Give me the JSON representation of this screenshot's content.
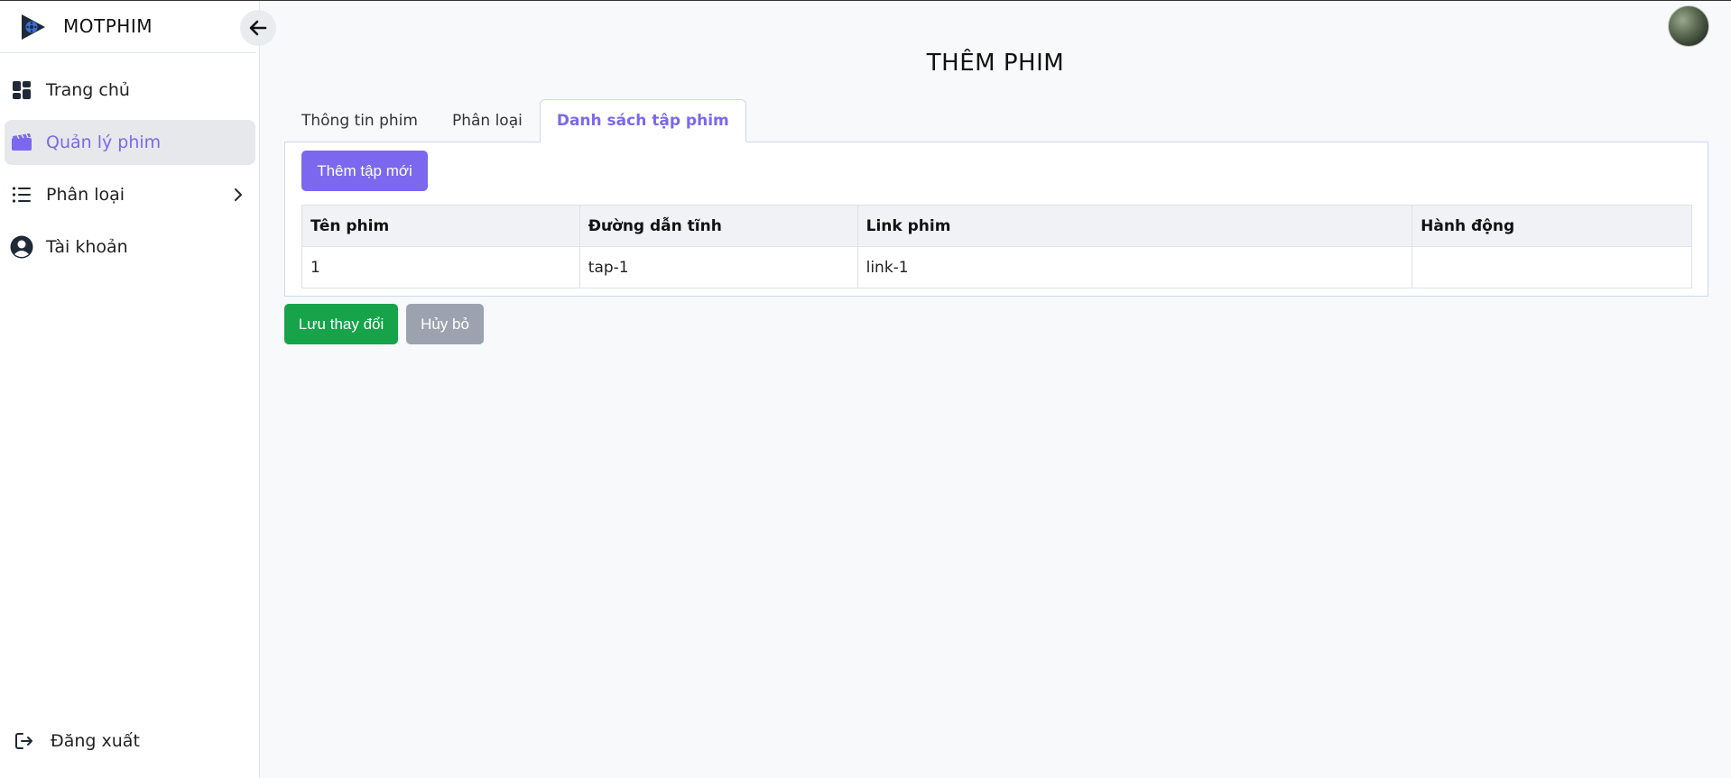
{
  "app": {
    "name": "MOTPHIM"
  },
  "sidebar": {
    "items": [
      {
        "label": "Trang chủ",
        "icon": "dashboard-icon"
      },
      {
        "label": "Quản lý phim",
        "icon": "film-icon",
        "active": true
      },
      {
        "label": "Phân loại",
        "icon": "list-icon"
      },
      {
        "label": "Tài khoản",
        "icon": "user-circle-icon"
      }
    ],
    "logout_label": "Đăng xuất"
  },
  "page": {
    "title": "THÊM PHIM"
  },
  "tabs": [
    {
      "label": "Thông tin phim"
    },
    {
      "label": "Phân loại"
    },
    {
      "label": "Danh sách tập phim",
      "active": true
    }
  ],
  "episodes": {
    "add_button": "Thêm tập mới",
    "columns": [
      "Tên phim",
      "Đường dẫn tĩnh",
      "Link phim",
      "Hành động"
    ],
    "rows": [
      {
        "name": "1",
        "slug": "tap-1",
        "link": "link-1",
        "actions": ""
      }
    ]
  },
  "footer_actions": {
    "save_label": "Lưu thay đổi",
    "cancel_label": "Hủy bỏ"
  },
  "colors": {
    "accent": "#7b68ee",
    "success": "#16a34a",
    "muted": "#9ca3af"
  }
}
